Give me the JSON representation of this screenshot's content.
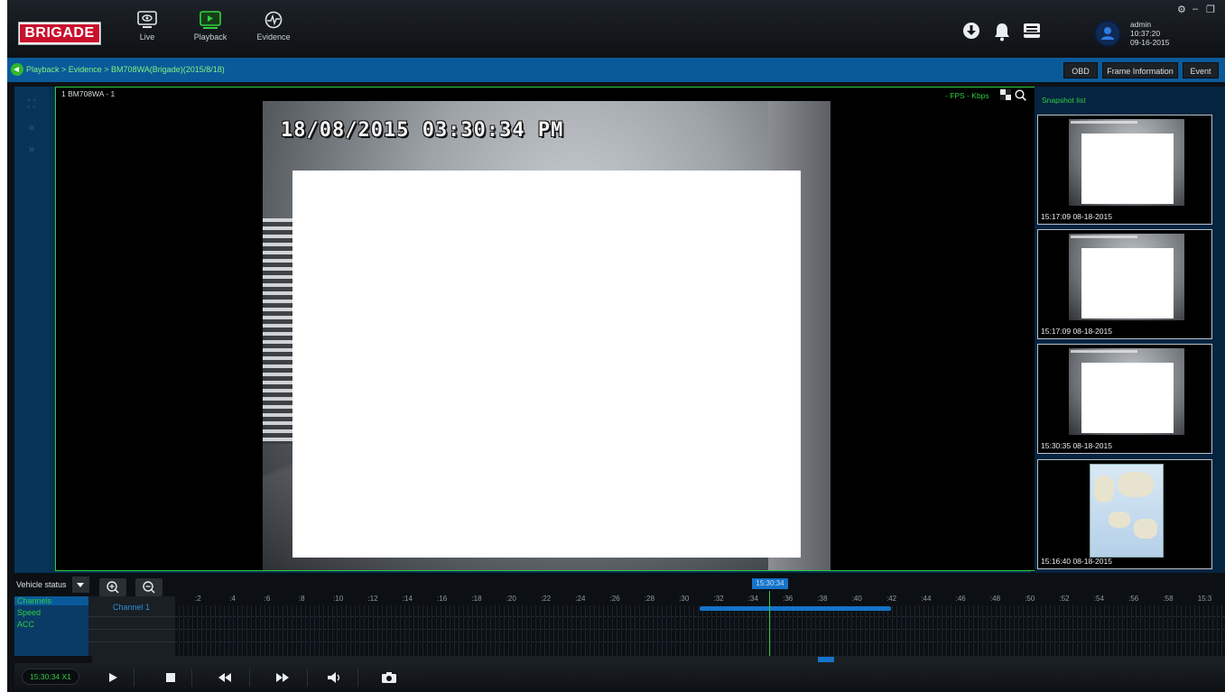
{
  "app": {
    "brand": "BRIGADE",
    "nav": [
      {
        "label": "Live",
        "icon": "eye-monitor-icon"
      },
      {
        "label": "Playback",
        "icon": "playback-icon"
      },
      {
        "label": "Evidence",
        "icon": "evidence-icon"
      }
    ],
    "top_icons": [
      "download-icon",
      "bell-icon",
      "inbox-icon"
    ],
    "user": {
      "name": "admin",
      "time": "10:37:20",
      "date": "09-16-2015"
    }
  },
  "breadcrumb": "Playback > Evidence > BM708WA(Brigade)(2015/8/18)",
  "toolbar": {
    "obd": "OBD",
    "frame_info": "Frame Information",
    "event": "Event"
  },
  "video": {
    "channel_label": "1 BM708WA - 1",
    "fps_kbps": "- FPS   - Kbps",
    "osd_timestamp": "18/08/2015 03:30:34 PM"
  },
  "snapshots": {
    "title": "Snapshot list",
    "items": [
      {
        "caption": "15:17:09 08-18-2015",
        "kind": "image"
      },
      {
        "caption": "15:17:09 08-18-2015",
        "kind": "image"
      },
      {
        "caption": "15:30:35 08-18-2015",
        "kind": "image"
      },
      {
        "caption": "15:16:40 08-18-2015",
        "kind": "map"
      }
    ]
  },
  "timeline": {
    "vehicle_status": "Vehicle status",
    "rows": [
      "Channels",
      "Speed",
      "ACC"
    ],
    "channel_name": "Channel 1",
    "cursor_time": "15:30:34",
    "ticks": [
      ":2",
      ":4",
      ":6",
      ":8",
      ":10",
      ":12",
      ":14",
      ":16",
      ":18",
      ":20",
      ":22",
      ":24",
      ":26",
      ":28",
      ":30",
      ":32",
      ":34",
      ":36",
      ":38",
      ":40",
      ":42",
      ":44",
      ":46",
      ":48",
      ":50",
      ":52",
      ":54",
      ":56",
      ":58",
      "15:3"
    ]
  },
  "controls": {
    "speed": "15:30:34   X1"
  },
  "colors": {
    "accent_blue": "#0a5a9a",
    "accent_green": "#2ecc40",
    "brand_red": "#c8102e"
  }
}
